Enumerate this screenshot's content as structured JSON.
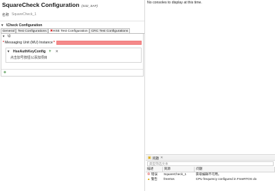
{
  "editor": {
    "title": "SquareCheck Configuration",
    "subtitle": "(S32_SAF)",
    "name_label": "名称",
    "name_value": "SquareCheck_1",
    "section_title": "\\Check Configuration",
    "tabs": [
      {
        "label": "General"
      },
      {
        "label": "Test Configurations"
      },
      {
        "label": "HSE Test Configuration",
        "error": true
      },
      {
        "label": "CRC Test Configurations"
      }
    ],
    "tree_root": "\\0",
    "field_label": "Messaging Unit (MU) Instance",
    "sub_title": "HseAuthKeyConfig",
    "sub_hint": "点击加号按钮以添加项目"
  },
  "console": {
    "message": "No consoles to display at this time."
  },
  "problems": {
    "tab_label": "问题",
    "filter_placeholder": "类型筛选文本",
    "columns": [
      "描述",
      "资源",
      "问题"
    ],
    "rows": [
      {
        "severity": "错误",
        "resource": "SquareCheck_1",
        "issue": "获取编辑不可用。"
      },
      {
        "severity": "警告",
        "resource": "freertos",
        "issue": "CPU frequency configured in FreeRTOS do"
      }
    ]
  },
  "colors": {
    "error_red": "#d62020",
    "field_error_bg": "#f5898a",
    "warning_yellow": "#d8a400"
  }
}
